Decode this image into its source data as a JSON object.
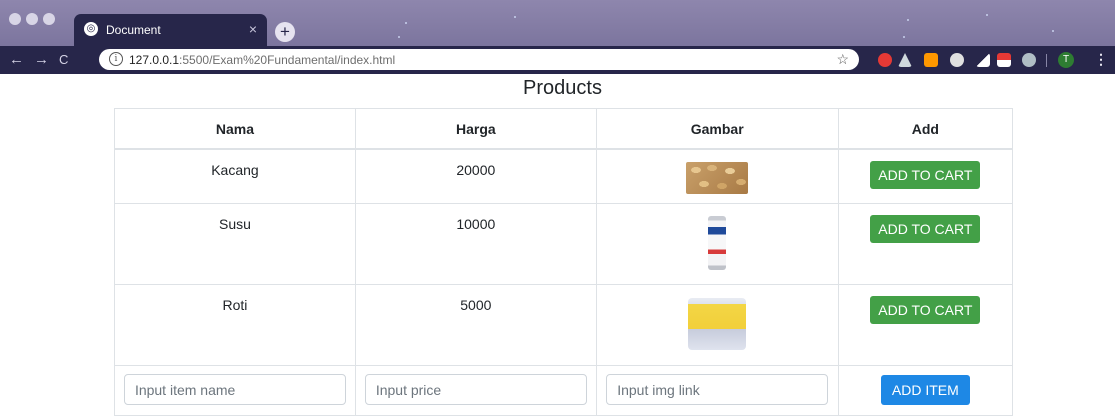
{
  "browser": {
    "tab_title": "Document",
    "tab_close": "×",
    "new_tab": "+",
    "url_host": "127.0.0.1",
    "url_rest": ":5500/Exam%20Fundamental/index.html",
    "info_glyph": "i",
    "avatar_letter": "T",
    "menu_glyph": "⋮",
    "back_glyph": "←",
    "forward_glyph": "→",
    "reload_glyph": "C",
    "star_glyph": "☆"
  },
  "page": {
    "title": "Products"
  },
  "table": {
    "headers": {
      "nama": "Nama",
      "harga": "Harga",
      "gambar": "Gambar",
      "add": "Add"
    },
    "rows": [
      {
        "nama": "Kacang",
        "harga": "20000",
        "image": "peanuts-image",
        "button": "ADD TO CART"
      },
      {
        "nama": "Susu",
        "harga": "10000",
        "image": "milk-can-image",
        "button": "ADD TO CART"
      },
      {
        "nama": "Roti",
        "harga": "5000",
        "image": "bread-package-image",
        "button": "ADD TO CART"
      }
    ],
    "form": {
      "name_placeholder": "Input item name",
      "price_placeholder": "Input price",
      "img_placeholder": "Input img link",
      "add_item_label": "ADD ITEM"
    }
  },
  "colors": {
    "tab_bar": "#7c759e",
    "toolbar": "#27264a",
    "add_to_cart": "#43a047",
    "add_item": "#1e88e5"
  }
}
